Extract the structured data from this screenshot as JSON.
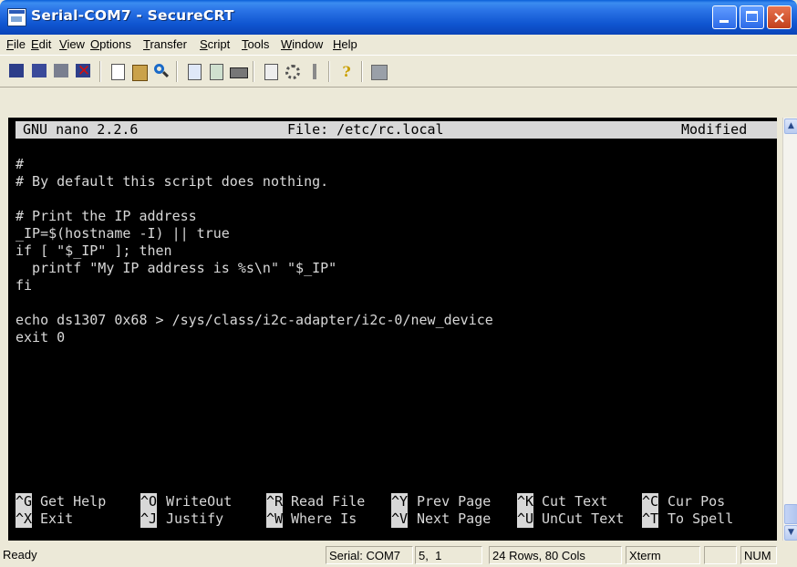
{
  "window": {
    "title": "Serial-COM7 - SecureCRT",
    "controls": {
      "minimize": "",
      "maximize": "",
      "close": "×"
    }
  },
  "menu": {
    "items": [
      "File",
      "Edit",
      "View",
      "Options",
      "Transfer",
      "Script",
      "Tools",
      "Window",
      "Help"
    ]
  },
  "toolbar": {
    "icons": [
      "connect-icon",
      "quick-connect-icon",
      "reconnect-icon",
      "disconnect-icon",
      "copy-icon",
      "paste-icon",
      "find-icon",
      "log-session-icon",
      "print-screen-icon",
      "print-icon",
      "session-options-icon",
      "global-options-icon",
      "keymap-icon",
      "help-icon",
      "sftp-icon"
    ]
  },
  "terminal": {
    "header": {
      "program": "GNU nano 2.2.6",
      "file": "File: /etc/rc.local",
      "status": "Modified"
    },
    "lines": [
      "#",
      "# By default this script does nothing.",
      "",
      "# Print the IP address",
      "_IP=$(hostname -I) || true",
      "if [ \"$_IP\" ]; then",
      "  printf \"My IP address is %s\\n\" \"$_IP\"",
      "fi",
      "",
      "echo ds1307 0x68 > /sys/class/i2c-adapter/i2c-0/new_device",
      "exit 0"
    ],
    "shortcuts_row1": [
      {
        "key": "^G",
        "label": "Get Help"
      },
      {
        "key": "^O",
        "label": "WriteOut"
      },
      {
        "key": "^R",
        "label": "Read File"
      },
      {
        "key": "^Y",
        "label": "Prev Page"
      },
      {
        "key": "^K",
        "label": "Cut Text"
      },
      {
        "key": "^C",
        "label": "Cur Pos"
      }
    ],
    "shortcuts_row2": [
      {
        "key": "^X",
        "label": "Exit"
      },
      {
        "key": "^J",
        "label": "Justify"
      },
      {
        "key": "^W",
        "label": "Where Is"
      },
      {
        "key": "^V",
        "label": "Next Page"
      },
      {
        "key": "^U",
        "label": "UnCut Text"
      },
      {
        "key": "^T",
        "label": "To Spell"
      }
    ]
  },
  "scrollbar": {
    "up_glyph": "▲",
    "down_glyph": "▼"
  },
  "status": {
    "ready": "Ready",
    "port": "Serial: COM7",
    "cursor": "5,  1",
    "size": "24 Rows, 80 Cols",
    "emulation": "Xterm",
    "blank": "",
    "num": "NUM"
  }
}
